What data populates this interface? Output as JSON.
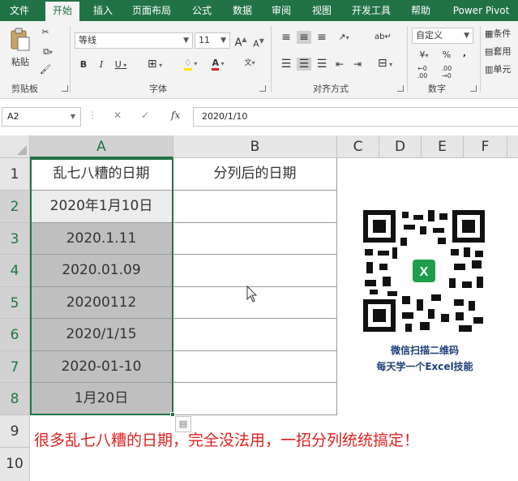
{
  "ribbon_tabs": [
    "文件",
    "开始",
    "插入",
    "页面布局",
    "公式",
    "数据",
    "审阅",
    "视图",
    "开发工具",
    "帮助",
    "Power Pivot"
  ],
  "active_tab": "开始",
  "clipboard": {
    "paste": "粘贴",
    "label": "剪贴板"
  },
  "font": {
    "name": "等线",
    "size": "11",
    "bold": "B",
    "italic": "I",
    "underline": "U",
    "grow": "A",
    "shrink": "A",
    "label": "字体"
  },
  "alignment": {
    "label": "对齐方式"
  },
  "number": {
    "format": "自定义",
    "percent": "%",
    "comma": ",",
    "label": "数字"
  },
  "styles": {
    "conditional": "条件",
    "table": "套用",
    "cell": "单元"
  },
  "formula_bar": {
    "name_box": "A2",
    "fx": "fx",
    "value": "2020/1/10"
  },
  "columns": [
    "A",
    "B",
    "C",
    "D",
    "E",
    "F"
  ],
  "rows": [
    "1",
    "2",
    "3",
    "4",
    "5",
    "6",
    "7",
    "8",
    "9",
    "10"
  ],
  "table": {
    "header_a": "乱七八糟的日期",
    "header_b": "分列后的日期",
    "dates": [
      "2020年1月10日",
      "2020.1.11",
      "2020.01.09",
      "20200112",
      "2020/1/15",
      "2020-01-10",
      "1月20日"
    ]
  },
  "note": "很多乱七八糟的日期，完全没法用，一招分列统统搞定！",
  "qr": {
    "caption1": "微信扫描二维码",
    "caption2": "每天学一个Excel技能",
    "logo": "X"
  }
}
